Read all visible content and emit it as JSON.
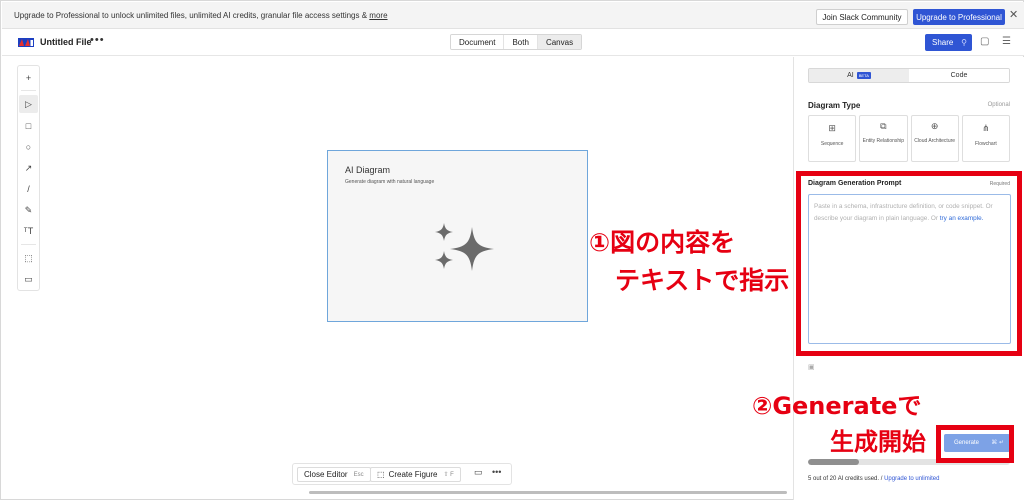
{
  "banner": {
    "message": "Upgrade to Professional to unlock unlimited files, unlimited AI credits, granular file access settings &",
    "more_link": "more",
    "slack_button": "Join Slack Community",
    "upgrade_button": "Upgrade to Professional",
    "close": "✕"
  },
  "topbar": {
    "file_title": "Untitled File",
    "more": "•••",
    "view_tabs": [
      "Document",
      "Both",
      "Canvas"
    ],
    "active_view": "Canvas",
    "share_label": "Share"
  },
  "toolbar": {
    "tools": [
      "+",
      "▷",
      "□",
      "○",
      "↗",
      "/",
      "✎",
      "ᵀT",
      "⬚",
      "▭"
    ],
    "active_tool": "select"
  },
  "card": {
    "title": "AI Diagram",
    "subtitle": "Generate diagram with natural language"
  },
  "bottom": {
    "close_editor": "Close Editor",
    "close_editor_key": "Esc",
    "create_figure": "Create Figure",
    "create_figure_key": "⇧ F",
    "more": "•••"
  },
  "panel": {
    "mode_tabs": [
      "AI",
      "Code"
    ],
    "beta_badge": "BETA",
    "active_mode": "AI",
    "diagram_type_title": "Diagram Type",
    "optional": "Optional",
    "types": [
      {
        "label": "Sequence",
        "icon": "sequence-icon"
      },
      {
        "label": "Entity Relationship",
        "icon": "entity-relationship-icon"
      },
      {
        "label": "Cloud Architecture",
        "icon": "cloud-architecture-icon"
      },
      {
        "label": "Flowchart",
        "icon": "flowchart-icon"
      }
    ],
    "prompt_title": "Diagram Generation Prompt",
    "required": "Required",
    "prompt_placeholder": "Paste in a schema, infrastructure definition, or code snippet. Or describe your diagram in plain language. Or",
    "prompt_example_link": "try an example.",
    "generate_label": "Generate",
    "generate_key": "⌘ ↵",
    "credits_progress": 0.25,
    "credits_text": "5 out of 20 AI credits used. /",
    "upgrade_link": "Upgrade to unlimited"
  },
  "annotations": {
    "step1_line1": "①図の内容を",
    "step1_line2": "テキストで指示",
    "step2_line1": "②Generateで",
    "step2_line2": "生成開始",
    "color": "#e60012"
  }
}
